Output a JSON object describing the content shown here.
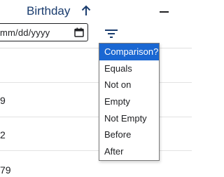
{
  "header": {
    "title": "Birthday",
    "sort_icon": "arrow-up-icon",
    "collapse_icon": "minus-icon",
    "date_input": {
      "placeholder": "mm/dd/yyyy",
      "display": "mm/dd/yyyy"
    },
    "calendar_icon": "calendar-icon",
    "filter_icon": "filter-icon"
  },
  "rows": [
    {
      "text": ""
    },
    {
      "text": "9"
    },
    {
      "text": "2"
    },
    {
      "text": "79"
    }
  ],
  "filter_menu": {
    "items": [
      {
        "label": "Comparison?",
        "selected": true
      },
      {
        "label": "Equals",
        "selected": false
      },
      {
        "label": "Not on",
        "selected": false
      },
      {
        "label": "Empty",
        "selected": false
      },
      {
        "label": "Not Empty",
        "selected": false
      },
      {
        "label": "Before",
        "selected": false
      },
      {
        "label": "After",
        "selected": false
      }
    ]
  },
  "colors": {
    "title": "#1a3c6e",
    "selected_bg": "#1a67d2",
    "selected_fg": "#ffffff",
    "grid_line": "#e3e3e3"
  }
}
